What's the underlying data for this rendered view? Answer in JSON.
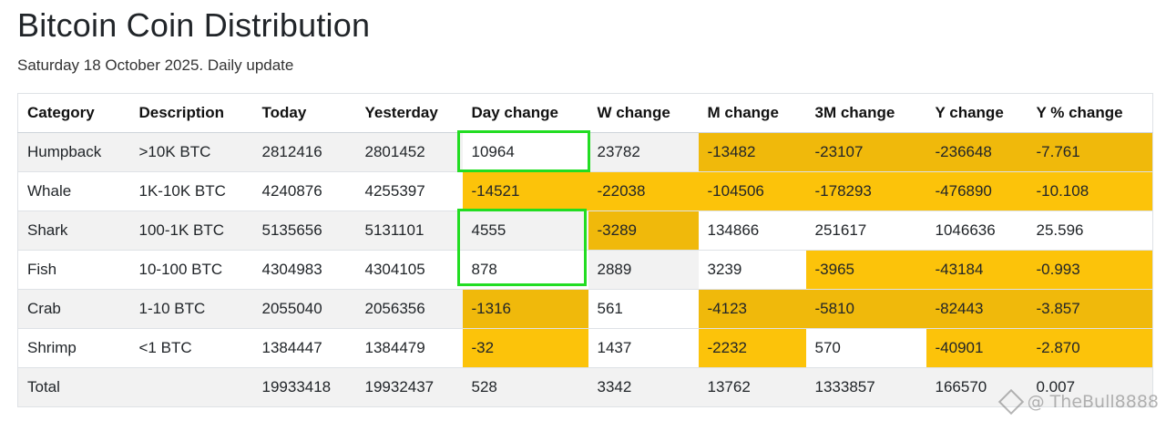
{
  "page": {
    "title": "Bitcoin Coin Distribution",
    "subtitle": "Saturday 18 October 2025. Daily update"
  },
  "table": {
    "headers": [
      "Category",
      "Description",
      "Today",
      "Yesterday",
      "Day change",
      "W change",
      "M change",
      "3M change",
      "Y change",
      "Y % change"
    ],
    "rows": [
      [
        "Humpback",
        ">10K BTC",
        "2812416",
        "2801452",
        "10964",
        "23782",
        "-13482",
        "-23107",
        "-236648",
        "-7.761"
      ],
      [
        "Whale",
        "1K-10K BTC",
        "4240876",
        "4255397",
        "-14521",
        "-22038",
        "-104506",
        "-178293",
        "-476890",
        "-10.108"
      ],
      [
        "Shark",
        "100-1K BTC",
        "5135656",
        "5131101",
        "4555",
        "-3289",
        "134866",
        "251617",
        "1046636",
        "25.596"
      ],
      [
        "Fish",
        "10-100 BTC",
        "4304983",
        "4304105",
        "878",
        "2889",
        "3239",
        "-3965",
        "-43184",
        "-0.993"
      ],
      [
        "Crab",
        "1-10 BTC",
        "2055040",
        "2056356",
        "-1316",
        "561",
        "-4123",
        "-5810",
        "-82443",
        "-3.857"
      ],
      [
        "Shrimp",
        "<1 BTC",
        "1384447",
        "1384479",
        "-32",
        "1437",
        "-2232",
        "570",
        "-40901",
        "-2.870"
      ],
      [
        "Total",
        "",
        "19933418",
        "19932437",
        "528",
        "3342",
        "13762",
        "1333857",
        "166570",
        "0.007"
      ]
    ]
  },
  "colors": {
    "highlight_dark": "#f0b90b",
    "highlight_yellow": "#fcc30a",
    "stripe": "#f2f2f2",
    "outline_green": "#22dd22"
  },
  "watermark": {
    "text": "@ TheBull8888"
  }
}
